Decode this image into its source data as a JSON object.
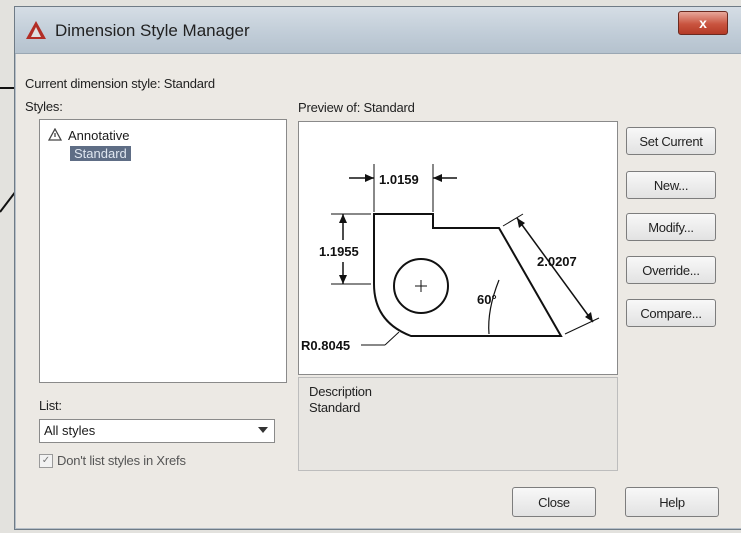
{
  "window": {
    "title": "Dimension Style Manager",
    "close_glyph": "x"
  },
  "current_style": {
    "text": "Current dimension style: Standard"
  },
  "styles": {
    "label": "Styles:",
    "items": [
      {
        "label": "Annotative",
        "icon": "annotative-icon"
      },
      {
        "label": "Standard",
        "selected": true
      }
    ]
  },
  "preview": {
    "label": "Preview of: Standard",
    "dims": {
      "top": "1.0159",
      "left": "1.1955",
      "angled": "2.0207",
      "angle": "60°",
      "radius": "R0.8045"
    }
  },
  "list": {
    "label": "List:",
    "selected": "All styles"
  },
  "xrefs": {
    "label": "Don't list styles in Xrefs",
    "checked": true
  },
  "description": {
    "label": "Description",
    "value": "Standard"
  },
  "buttons": {
    "set_current": "Set Current",
    "new": "New...",
    "modify": "Modify...",
    "override": "Override...",
    "compare": "Compare...",
    "close": "Close",
    "help": "Help"
  }
}
